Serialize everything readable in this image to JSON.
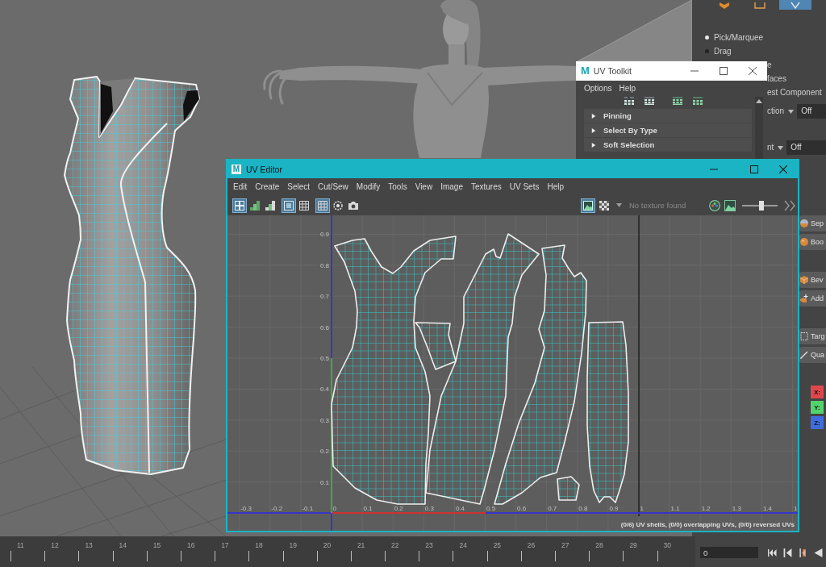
{
  "side_panel": {
    "tool_tabs": [
      {
        "kind": "cube",
        "selected": false
      },
      {
        "kind": "frame",
        "selected": false
      },
      {
        "kind": "diamond",
        "selected": true
      }
    ],
    "selection_modes": [
      {
        "label": "Pick/Marquee",
        "selected": true
      },
      {
        "label": "Drag",
        "selected": false
      }
    ],
    "options": [
      {
        "kind": "text",
        "label": "e"
      },
      {
        "kind": "text",
        "label": "faces"
      },
      {
        "kind": "text",
        "label": "est Component"
      },
      {
        "kind": "dropdown",
        "label": "ction",
        "value": "Off"
      },
      {
        "kind": "dropdown",
        "label": "nt",
        "value": "Off"
      }
    ],
    "tool_groups": [
      [
        {
          "kind": "split",
          "label": "Sep"
        },
        {
          "kind": "sphere",
          "label": "Boo"
        }
      ],
      [
        {
          "kind": "cube",
          "label": "Bev"
        },
        {
          "kind": "add",
          "label": "Add"
        }
      ],
      [
        {
          "kind": "target",
          "label": "Targ"
        },
        {
          "kind": "pen",
          "label": "Qua"
        }
      ]
    ],
    "axes": [
      {
        "label": "X:",
        "color": "#e0474c"
      },
      {
        "label": "Y:",
        "color": "#52d46c"
      },
      {
        "label": "Z:",
        "color": "#3f6de0"
      }
    ]
  },
  "uv_toolkit": {
    "logo": "M",
    "title": "UV Toolkit",
    "menu": [
      "Options",
      "Help"
    ],
    "sections": [
      {
        "label": "Pinning",
        "expanded": false
      },
      {
        "label": "Select By Type",
        "expanded": false
      },
      {
        "label": "Soft Selection",
        "expanded": false
      }
    ]
  },
  "uv_editor": {
    "logo": "M",
    "title": "UV Editor",
    "menu": [
      "Edit",
      "Create",
      "Select",
      "Cut/Sew",
      "Modify",
      "Tools",
      "View",
      "Image",
      "Textures",
      "UV Sets",
      "Help"
    ],
    "toolbar_groups": [
      [
        {
          "kind": "shells",
          "selected": true
        },
        {
          "kind": "stairs",
          "selected": false
        },
        {
          "kind": "steps",
          "selected": false
        }
      ],
      [
        {
          "kind": "frame",
          "selected": true
        },
        {
          "kind": "grid",
          "selected": false
        }
      ],
      [
        {
          "kind": "grid",
          "selected": true
        },
        {
          "kind": "ring",
          "selected": false
        },
        {
          "kind": "camera",
          "selected": false
        }
      ]
    ],
    "display_toggles": [
      {
        "kind": "image",
        "selected": true
      },
      {
        "kind": "checker",
        "selected": false
      }
    ],
    "texture_field": {
      "placeholder": "No texture found"
    },
    "exposure": {
      "level": 0.55
    },
    "u_labels": [
      "-0.3",
      "-0.2",
      "-0.1",
      "0",
      "0.1",
      "0.2",
      "0.3",
      "0.4",
      "0.5",
      "0.6",
      "0.7",
      "0.8",
      "0.9",
      "1",
      "1.1",
      "1.2",
      "1.3",
      "1.4",
      "1"
    ],
    "v_labels": [
      "0.9",
      "0.8",
      "0.7",
      "0.6",
      "0.5",
      "0.4",
      "0.3",
      "0.2",
      "0.1"
    ],
    "status": "(0/6) UV shells, (0/0) overlapping UVs, (0/0) reversed UVs"
  },
  "timeline": {
    "frames": [
      "11",
      "12",
      "13",
      "14",
      "15",
      "16",
      "17",
      "18",
      "19",
      "20",
      "21",
      "22",
      "23",
      "24",
      "25",
      "26",
      "27",
      "28",
      "29",
      "30"
    ],
    "current_frame": "0"
  }
}
